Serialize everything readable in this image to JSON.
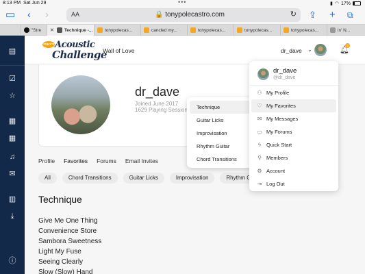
{
  "statusbar": {
    "time": "8:13 PM",
    "date": "Sat Jun 29",
    "battery": "17%"
  },
  "browser": {
    "reader_label": "AA",
    "url": "tonypolecastro.com",
    "tabs": [
      {
        "label": "\"Stre",
        "favicon_color": "#111111"
      },
      {
        "label": "Technique -...",
        "favicon_color": "#555555"
      },
      {
        "label": "tonypolecas...",
        "favicon_color": "#f5a623"
      },
      {
        "label": "cancled my...",
        "favicon_color": "#f5a623"
      },
      {
        "label": "tonypolecas...",
        "favicon_color": "#f5a623"
      },
      {
        "label": "tonypolecas...",
        "favicon_color": "#f5a623"
      },
      {
        "label": "tonypolecas...",
        "favicon_color": "#f5a623"
      },
      {
        "label": "in' N...",
        "favicon_color": "#999999"
      }
    ]
  },
  "header": {
    "logo_badge": "TONY'S",
    "logo_line1": "Acoustic",
    "logo_line2": "Challenge",
    "nav_link": "Wall of Love",
    "username": "dr_dave",
    "notification_count": "2"
  },
  "profile": {
    "name": "dr_dave",
    "joined": "Joined June 2017",
    "sessions": "1629 Playing Sessions",
    "tabs": [
      "Profile",
      "Favorites",
      "Forums",
      "Email Invites"
    ],
    "filters": [
      "All",
      "Chord Transitions",
      "Guitar Licks",
      "Improvisation",
      "Rhythm Guitar"
    ],
    "section_title": "Technique",
    "songs": [
      "Give Me One Thing",
      "Convenience Store",
      "Sambora Sweetness",
      "Light My Fuse",
      "Seeing Clearly",
      "Slow (Slow) Hand"
    ]
  },
  "favorites_submenu": [
    "Technique",
    "Guitar Licks",
    "Improvisation",
    "Rhythm Guitar",
    "Chord Transitions"
  ],
  "user_menu": {
    "name": "dr_dave",
    "handle": "@dr_dave",
    "items": [
      {
        "label": "My Profile",
        "icon": "user-icon"
      },
      {
        "label": "My Favorites",
        "icon": "heart-icon"
      },
      {
        "label": "My Messages",
        "icon": "envelope-icon"
      },
      {
        "label": "My Forums",
        "icon": "chat-icon"
      },
      {
        "label": "Quick Start",
        "icon": "bolt-icon"
      },
      {
        "label": "Members",
        "icon": "search-icon"
      },
      {
        "label": "Account",
        "icon": "gear-icon"
      },
      {
        "label": "Log Out",
        "icon": "logout-icon"
      }
    ]
  },
  "colors": {
    "sidebar": "#12294a",
    "accent": "#f5a623",
    "safari_blue": "#1a73e8"
  }
}
